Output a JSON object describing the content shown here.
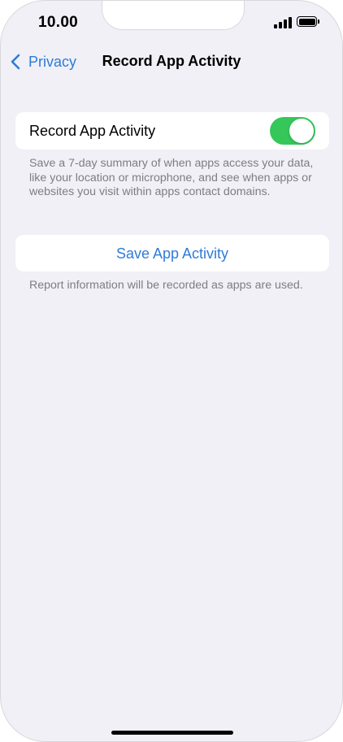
{
  "status": {
    "time": "10.00",
    "icons": [
      "signal-icon",
      "battery-icon"
    ]
  },
  "nav": {
    "back_label": "Privacy",
    "title": "Record App Activity",
    "back_icon": "chevron-left-icon"
  },
  "settings": {
    "record_label": "Record App Activity",
    "record_toggle_on": true,
    "record_description": "Save a 7-day summary of when apps access your data, like your location or microphone, and see when apps or websites you visit within apps contact domains.",
    "save_button_label": "Save App Activity",
    "save_description": "Report information will be recorded as apps are used."
  },
  "colors": {
    "accent": "#2f7bd8",
    "toggle_on": "#35c759",
    "background": "#f0f0f6",
    "secondary_text": "#7d7d82"
  }
}
